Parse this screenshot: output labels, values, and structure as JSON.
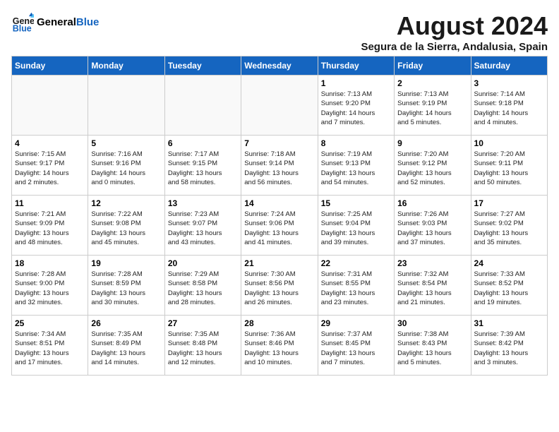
{
  "header": {
    "logo_general": "General",
    "logo_blue": "Blue",
    "month_year": "August 2024",
    "location": "Segura de la Sierra, Andalusia, Spain"
  },
  "weekdays": [
    "Sunday",
    "Monday",
    "Tuesday",
    "Wednesday",
    "Thursday",
    "Friday",
    "Saturday"
  ],
  "weeks": [
    {
      "days": [
        {
          "num": "",
          "info": ""
        },
        {
          "num": "",
          "info": ""
        },
        {
          "num": "",
          "info": ""
        },
        {
          "num": "",
          "info": ""
        },
        {
          "num": "1",
          "info": "Sunrise: 7:13 AM\nSunset: 9:20 PM\nDaylight: 14 hours\nand 7 minutes."
        },
        {
          "num": "2",
          "info": "Sunrise: 7:13 AM\nSunset: 9:19 PM\nDaylight: 14 hours\nand 5 minutes."
        },
        {
          "num": "3",
          "info": "Sunrise: 7:14 AM\nSunset: 9:18 PM\nDaylight: 14 hours\nand 4 minutes."
        }
      ]
    },
    {
      "days": [
        {
          "num": "4",
          "info": "Sunrise: 7:15 AM\nSunset: 9:17 PM\nDaylight: 14 hours\nand 2 minutes."
        },
        {
          "num": "5",
          "info": "Sunrise: 7:16 AM\nSunset: 9:16 PM\nDaylight: 14 hours\nand 0 minutes."
        },
        {
          "num": "6",
          "info": "Sunrise: 7:17 AM\nSunset: 9:15 PM\nDaylight: 13 hours\nand 58 minutes."
        },
        {
          "num": "7",
          "info": "Sunrise: 7:18 AM\nSunset: 9:14 PM\nDaylight: 13 hours\nand 56 minutes."
        },
        {
          "num": "8",
          "info": "Sunrise: 7:19 AM\nSunset: 9:13 PM\nDaylight: 13 hours\nand 54 minutes."
        },
        {
          "num": "9",
          "info": "Sunrise: 7:20 AM\nSunset: 9:12 PM\nDaylight: 13 hours\nand 52 minutes."
        },
        {
          "num": "10",
          "info": "Sunrise: 7:20 AM\nSunset: 9:11 PM\nDaylight: 13 hours\nand 50 minutes."
        }
      ]
    },
    {
      "days": [
        {
          "num": "11",
          "info": "Sunrise: 7:21 AM\nSunset: 9:09 PM\nDaylight: 13 hours\nand 48 minutes."
        },
        {
          "num": "12",
          "info": "Sunrise: 7:22 AM\nSunset: 9:08 PM\nDaylight: 13 hours\nand 45 minutes."
        },
        {
          "num": "13",
          "info": "Sunrise: 7:23 AM\nSunset: 9:07 PM\nDaylight: 13 hours\nand 43 minutes."
        },
        {
          "num": "14",
          "info": "Sunrise: 7:24 AM\nSunset: 9:06 PM\nDaylight: 13 hours\nand 41 minutes."
        },
        {
          "num": "15",
          "info": "Sunrise: 7:25 AM\nSunset: 9:04 PM\nDaylight: 13 hours\nand 39 minutes."
        },
        {
          "num": "16",
          "info": "Sunrise: 7:26 AM\nSunset: 9:03 PM\nDaylight: 13 hours\nand 37 minutes."
        },
        {
          "num": "17",
          "info": "Sunrise: 7:27 AM\nSunset: 9:02 PM\nDaylight: 13 hours\nand 35 minutes."
        }
      ]
    },
    {
      "days": [
        {
          "num": "18",
          "info": "Sunrise: 7:28 AM\nSunset: 9:00 PM\nDaylight: 13 hours\nand 32 minutes."
        },
        {
          "num": "19",
          "info": "Sunrise: 7:28 AM\nSunset: 8:59 PM\nDaylight: 13 hours\nand 30 minutes."
        },
        {
          "num": "20",
          "info": "Sunrise: 7:29 AM\nSunset: 8:58 PM\nDaylight: 13 hours\nand 28 minutes."
        },
        {
          "num": "21",
          "info": "Sunrise: 7:30 AM\nSunset: 8:56 PM\nDaylight: 13 hours\nand 26 minutes."
        },
        {
          "num": "22",
          "info": "Sunrise: 7:31 AM\nSunset: 8:55 PM\nDaylight: 13 hours\nand 23 minutes."
        },
        {
          "num": "23",
          "info": "Sunrise: 7:32 AM\nSunset: 8:54 PM\nDaylight: 13 hours\nand 21 minutes."
        },
        {
          "num": "24",
          "info": "Sunrise: 7:33 AM\nSunset: 8:52 PM\nDaylight: 13 hours\nand 19 minutes."
        }
      ]
    },
    {
      "days": [
        {
          "num": "25",
          "info": "Sunrise: 7:34 AM\nSunset: 8:51 PM\nDaylight: 13 hours\nand 17 minutes."
        },
        {
          "num": "26",
          "info": "Sunrise: 7:35 AM\nSunset: 8:49 PM\nDaylight: 13 hours\nand 14 minutes."
        },
        {
          "num": "27",
          "info": "Sunrise: 7:35 AM\nSunset: 8:48 PM\nDaylight: 13 hours\nand 12 minutes."
        },
        {
          "num": "28",
          "info": "Sunrise: 7:36 AM\nSunset: 8:46 PM\nDaylight: 13 hours\nand 10 minutes."
        },
        {
          "num": "29",
          "info": "Sunrise: 7:37 AM\nSunset: 8:45 PM\nDaylight: 13 hours\nand 7 minutes."
        },
        {
          "num": "30",
          "info": "Sunrise: 7:38 AM\nSunset: 8:43 PM\nDaylight: 13 hours\nand 5 minutes."
        },
        {
          "num": "31",
          "info": "Sunrise: 7:39 AM\nSunset: 8:42 PM\nDaylight: 13 hours\nand 3 minutes."
        }
      ]
    }
  ]
}
